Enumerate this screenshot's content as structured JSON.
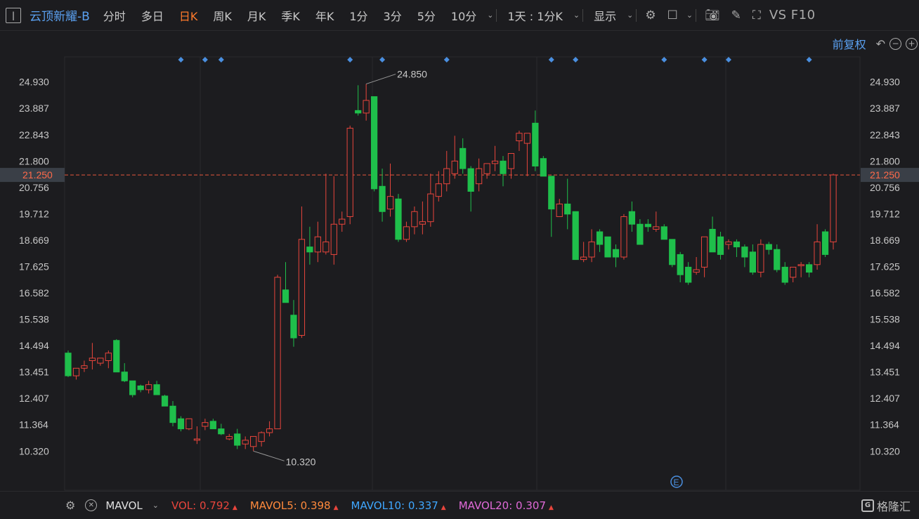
{
  "toolbar": {
    "stock_name": "云顶新耀-B",
    "tabs": [
      "分时",
      "多日",
      "日K",
      "周K",
      "月K",
      "季K",
      "年K",
      "1分",
      "3分",
      "5分",
      "10分"
    ],
    "active_tab": "日K",
    "period_select": "1天 : 1分K",
    "display_label": "显示",
    "vs_f10": "VS F10"
  },
  "adjust_label": "前复权",
  "chart_data": {
    "type": "candlestick",
    "y_ticks": [
      24.93,
      23.887,
      22.843,
      21.8,
      20.756,
      19.712,
      18.669,
      17.625,
      16.582,
      15.538,
      14.494,
      13.451,
      12.407,
      11.364,
      10.32
    ],
    "y_tick_labels": [
      "24.930",
      "23.887",
      "22.843",
      "21.800",
      "20.756",
      "19.712",
      "18.669",
      "17.625",
      "16.582",
      "15.538",
      "14.494",
      "13.451",
      "12.407",
      "11.364",
      "10.320"
    ],
    "ylim": [
      9.8,
      25.7
    ],
    "current_price": 21.25,
    "current_price_label": "21.250",
    "max_label": "24.850",
    "min_label": "10.320",
    "marker_count": 12,
    "event_marker": "E",
    "colors": {
      "up": "#e8453c",
      "down": "#1fbf4b",
      "price_line": "#e8573c",
      "marker": "#4a8fe0",
      "grid": "#2a2a2e",
      "axis_label": "#c8c8c8"
    },
    "candles": [
      [
        14.2,
        14.3,
        13.25,
        13.3
      ],
      [
        13.3,
        13.6,
        13.15,
        13.6
      ],
      [
        13.6,
        13.9,
        13.45,
        13.7
      ],
      [
        13.9,
        14.6,
        13.55,
        14.0
      ],
      [
        13.8,
        14.0,
        13.7,
        14.0
      ],
      [
        13.9,
        14.3,
        13.6,
        14.2
      ],
      [
        14.7,
        14.75,
        13.45,
        13.45
      ],
      [
        13.45,
        13.8,
        13.05,
        13.1
      ],
      [
        13.1,
        13.1,
        12.45,
        12.55
      ],
      [
        12.9,
        12.95,
        12.65,
        12.75
      ],
      [
        12.75,
        13.1,
        12.6,
        12.95
      ],
      [
        12.95,
        13.1,
        12.55,
        12.55
      ],
      [
        12.5,
        12.55,
        12.1,
        12.1
      ],
      [
        12.1,
        12.3,
        11.3,
        11.45
      ],
      [
        11.6,
        11.7,
        11.1,
        11.2
      ],
      [
        11.2,
        11.6,
        11.15,
        11.6
      ],
      [
        10.75,
        11.3,
        10.6,
        10.8
      ],
      [
        11.3,
        11.6,
        11.15,
        11.45
      ],
      [
        11.5,
        11.6,
        11.2,
        11.2
      ],
      [
        11.2,
        11.4,
        10.95,
        11.0
      ],
      [
        10.8,
        11.0,
        10.75,
        10.9
      ],
      [
        11.0,
        11.2,
        10.4,
        10.55
      ],
      [
        10.6,
        10.9,
        10.4,
        10.75
      ],
      [
        10.5,
        10.9,
        10.32,
        10.9
      ],
      [
        10.7,
        11.1,
        10.5,
        11.05
      ],
      [
        11.05,
        11.5,
        10.9,
        11.2
      ],
      [
        11.2,
        17.3,
        11.2,
        17.2
      ],
      [
        16.7,
        17.8,
        16.2,
        16.2
      ],
      [
        15.7,
        16.3,
        14.45,
        14.8
      ],
      [
        14.9,
        20.0,
        14.8,
        18.7
      ],
      [
        18.4,
        19.2,
        17.7,
        18.2
      ],
      [
        18.2,
        19.4,
        17.8,
        18.8
      ],
      [
        18.2,
        21.3,
        18.1,
        18.6
      ],
      [
        18.1,
        21.2,
        17.7,
        19.3
      ],
      [
        19.3,
        19.8,
        19.0,
        19.5
      ],
      [
        19.6,
        23.2,
        19.3,
        23.1
      ],
      [
        23.8,
        24.8,
        23.6,
        23.7
      ],
      [
        23.7,
        24.85,
        23.4,
        24.2
      ],
      [
        24.35,
        24.35,
        20.6,
        20.7
      ],
      [
        20.8,
        21.5,
        19.4,
        19.8
      ],
      [
        19.9,
        21.7,
        19.6,
        20.4
      ],
      [
        20.3,
        20.5,
        18.6,
        18.7
      ],
      [
        18.7,
        19.4,
        18.6,
        19.2
      ],
      [
        19.2,
        20.0,
        18.9,
        19.8
      ],
      [
        19.3,
        20.2,
        18.9,
        19.4
      ],
      [
        19.4,
        21.3,
        19.2,
        20.5
      ],
      [
        20.4,
        21.4,
        20.2,
        20.9
      ],
      [
        20.9,
        22.2,
        20.6,
        21.5
      ],
      [
        21.3,
        22.8,
        21.1,
        21.8
      ],
      [
        22.3,
        22.7,
        21.3,
        21.5
      ],
      [
        21.5,
        21.6,
        19.8,
        20.6
      ],
      [
        20.9,
        21.9,
        20.6,
        21.5
      ],
      [
        21.3,
        21.6,
        21.1,
        21.7
      ],
      [
        21.7,
        22.4,
        21.4,
        21.8
      ],
      [
        21.8,
        22.0,
        20.8,
        21.3
      ],
      [
        21.5,
        22.0,
        21.1,
        22.1
      ],
      [
        22.6,
        23.0,
        22.2,
        22.9
      ],
      [
        22.5,
        22.9,
        21.2,
        22.9
      ],
      [
        23.3,
        23.8,
        21.4,
        21.6
      ],
      [
        21.9,
        22.0,
        21.2,
        21.2
      ],
      [
        21.2,
        21.2,
        18.8,
        19.9
      ],
      [
        19.6,
        20.3,
        19.6,
        20.1
      ],
      [
        20.1,
        21.1,
        19.1,
        19.7
      ],
      [
        19.8,
        19.8,
        17.9,
        17.9
      ],
      [
        17.9,
        18.6,
        17.8,
        18.0
      ],
      [
        18.0,
        19.1,
        17.8,
        18.6
      ],
      [
        19.0,
        19.1,
        18.2,
        18.5
      ],
      [
        18.8,
        18.8,
        18.0,
        18.0
      ],
      [
        18.3,
        18.5,
        17.6,
        18.0
      ],
      [
        18.0,
        19.7,
        17.9,
        19.6
      ],
      [
        19.8,
        20.2,
        19.0,
        19.3
      ],
      [
        19.3,
        19.5,
        18.5,
        18.5
      ],
      [
        19.3,
        19.5,
        19.0,
        19.2
      ],
      [
        19.1,
        19.8,
        19.0,
        19.2
      ],
      [
        19.2,
        19.3,
        18.7,
        18.7
      ],
      [
        18.7,
        18.7,
        17.6,
        17.7
      ],
      [
        18.1,
        18.2,
        17.0,
        17.3
      ],
      [
        17.6,
        17.8,
        16.9,
        17.0
      ],
      [
        17.4,
        18.0,
        17.3,
        17.5
      ],
      [
        17.6,
        18.7,
        17.2,
        18.8
      ],
      [
        19.1,
        19.6,
        18.2,
        18.2
      ],
      [
        18.8,
        19.0,
        17.9,
        18.1
      ],
      [
        18.5,
        18.7,
        18.3,
        18.6
      ],
      [
        18.6,
        18.7,
        18.0,
        18.4
      ],
      [
        18.4,
        18.5,
        17.6,
        18.0
      ],
      [
        18.2,
        18.5,
        17.3,
        17.4
      ],
      [
        17.4,
        18.7,
        17.2,
        18.5
      ],
      [
        18.5,
        18.6,
        18.1,
        18.3
      ],
      [
        18.3,
        18.5,
        17.4,
        17.5
      ],
      [
        17.6,
        17.8,
        16.9,
        17.0
      ],
      [
        17.2,
        17.5,
        17.0,
        17.6
      ],
      [
        17.7,
        17.8,
        17.2,
        17.7
      ],
      [
        17.7,
        17.8,
        17.2,
        17.4
      ],
      [
        17.7,
        19.3,
        17.5,
        18.6
      ],
      [
        19.0,
        19.1,
        18.0,
        18.1
      ],
      [
        18.6,
        21.3,
        18.3,
        21.25
      ]
    ]
  },
  "volume_bar": {
    "name": "MAVOL",
    "vol_label": "VOL:",
    "vol_value": "0.792",
    "mavol5_label": "MAVOL5:",
    "mavol5_value": "0.398",
    "mavol10_label": "MAVOL10:",
    "mavol10_value": "0.337",
    "mavol20_label": "MAVOL20:",
    "mavol20_value": "0.307",
    "colors": {
      "vol": "#e8453c",
      "mavol5": "#ff8a3c",
      "mavol10": "#3fa7ff",
      "mavol20": "#e06ad8"
    }
  },
  "brand": "格隆汇"
}
